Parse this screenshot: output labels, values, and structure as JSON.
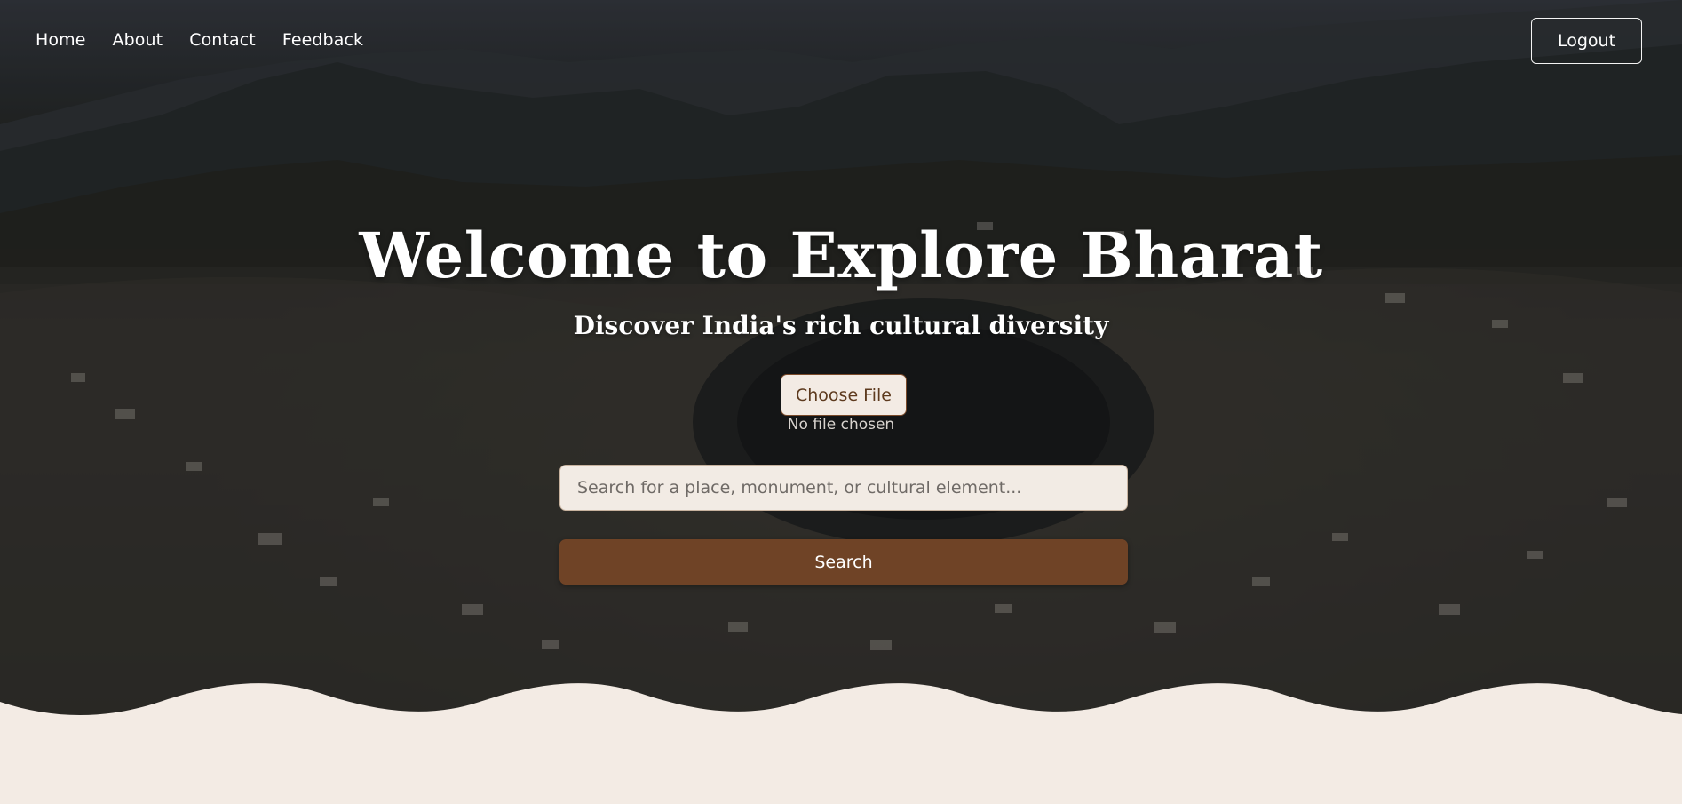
{
  "nav": {
    "items": [
      {
        "label": "Home"
      },
      {
        "label": "About"
      },
      {
        "label": "Contact"
      },
      {
        "label": "Feedback"
      }
    ],
    "logout_label": "Logout"
  },
  "hero": {
    "title": "Welcome to Explore Bharat",
    "subtitle": "Discover India's rich cultural diversity",
    "file": {
      "button_label": "Choose File",
      "status": "No file chosen"
    },
    "search": {
      "placeholder": "Search for a place, monument, or cultural element...",
      "value": "",
      "button_label": "Search"
    }
  },
  "colors": {
    "accent": "#6f4326",
    "background": "#f3ebe4",
    "text_light": "#ffffff"
  }
}
